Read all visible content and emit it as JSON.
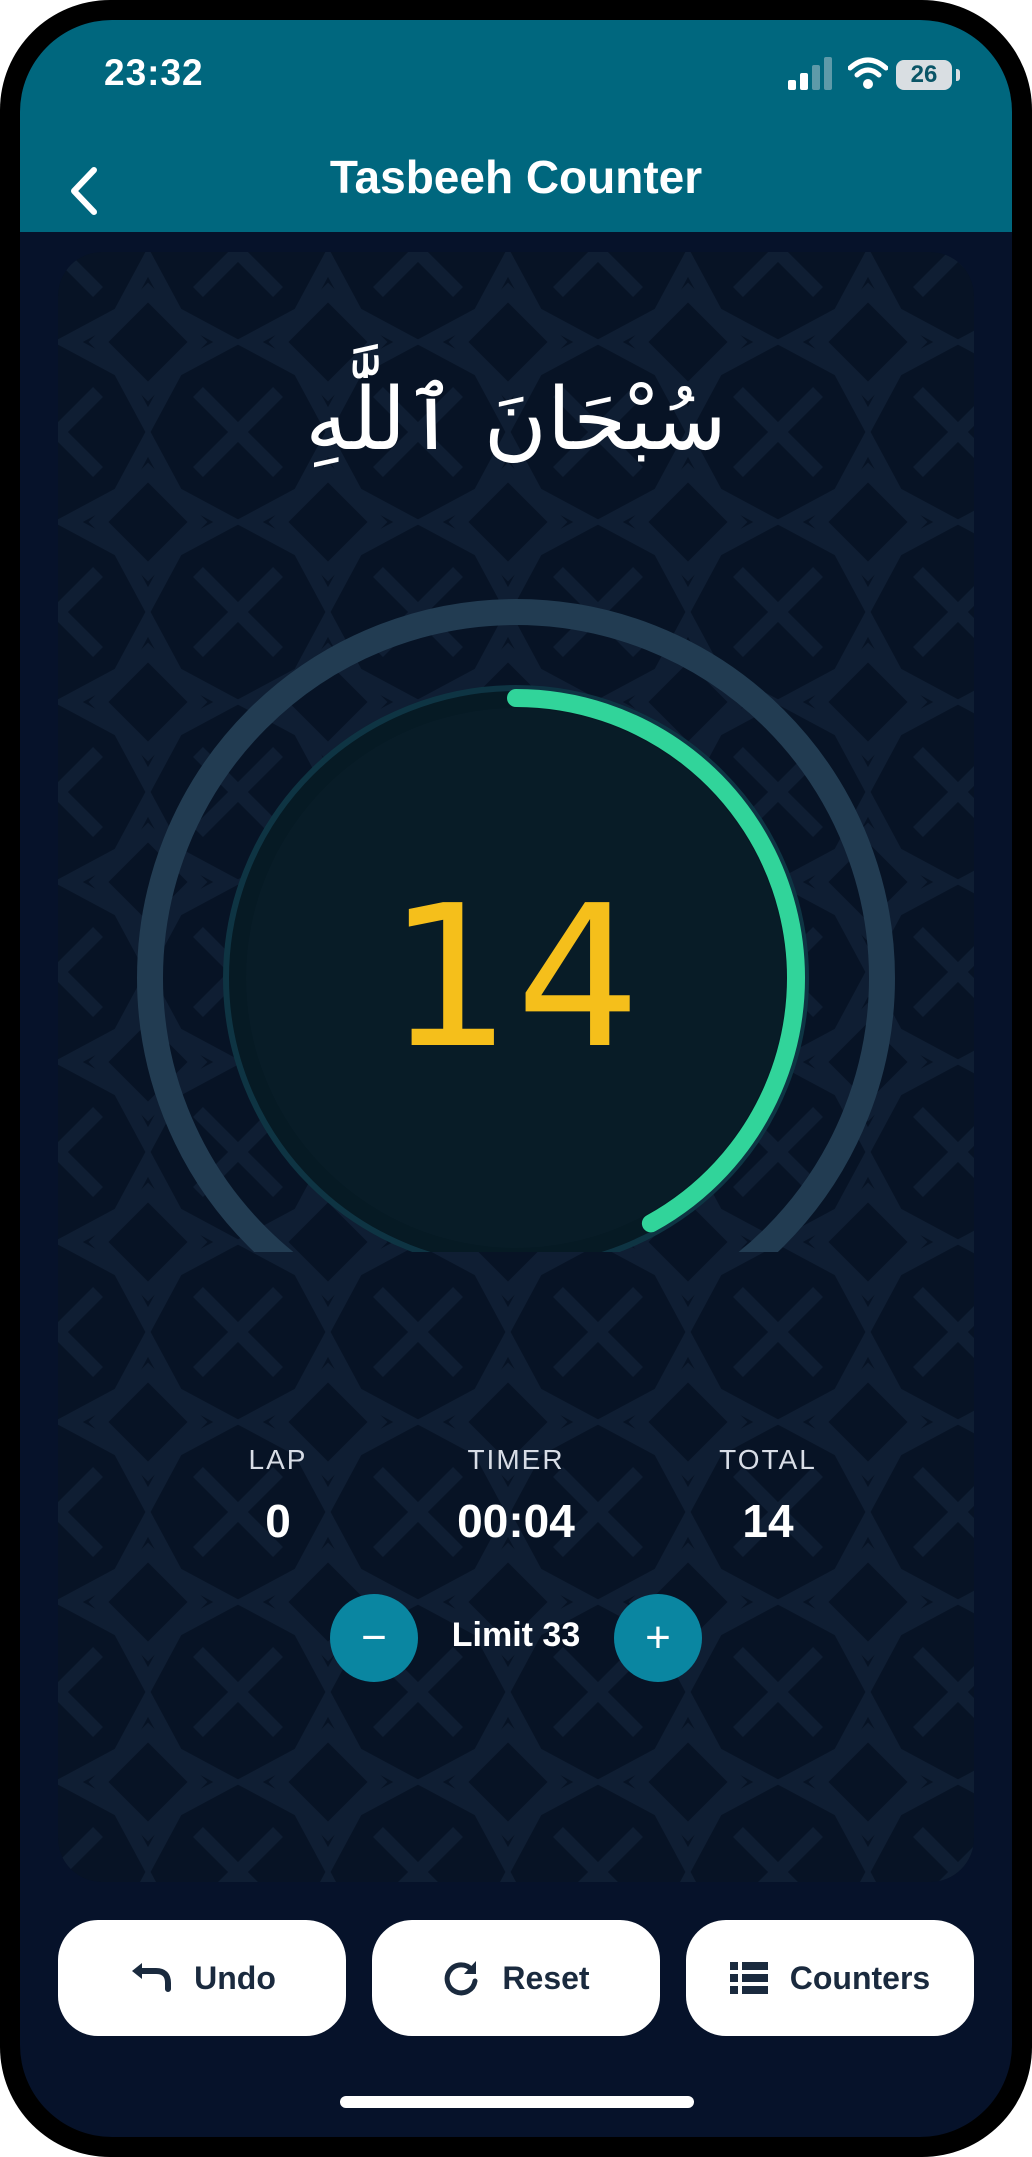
{
  "status_bar": {
    "time": "23:32",
    "battery": "26"
  },
  "header": {
    "title": "Tasbeeh Counter",
    "back_icon": "chevron-left-icon"
  },
  "dhikr": {
    "arabic": "سُبْحَانَ ٱللَّٰهِ"
  },
  "counter": {
    "count": "14",
    "progress_fraction": 0.42,
    "accent_color": "#31d49a",
    "number_color": "#f5bf1b"
  },
  "stats": {
    "lap_label": "LAP",
    "lap_value": "0",
    "timer_label": "TIMER",
    "timer_value": "00:04",
    "total_label": "TOTAL",
    "total_value": "14"
  },
  "limit": {
    "label": "Limit 33",
    "decrease_symbol": "−",
    "increase_symbol": "+"
  },
  "actions": {
    "undo": "Undo",
    "reset": "Reset",
    "counters": "Counters"
  },
  "colors": {
    "header_bg": "#00677e",
    "screen_bg": "#06122a",
    "button_accent": "#0a86a1"
  }
}
